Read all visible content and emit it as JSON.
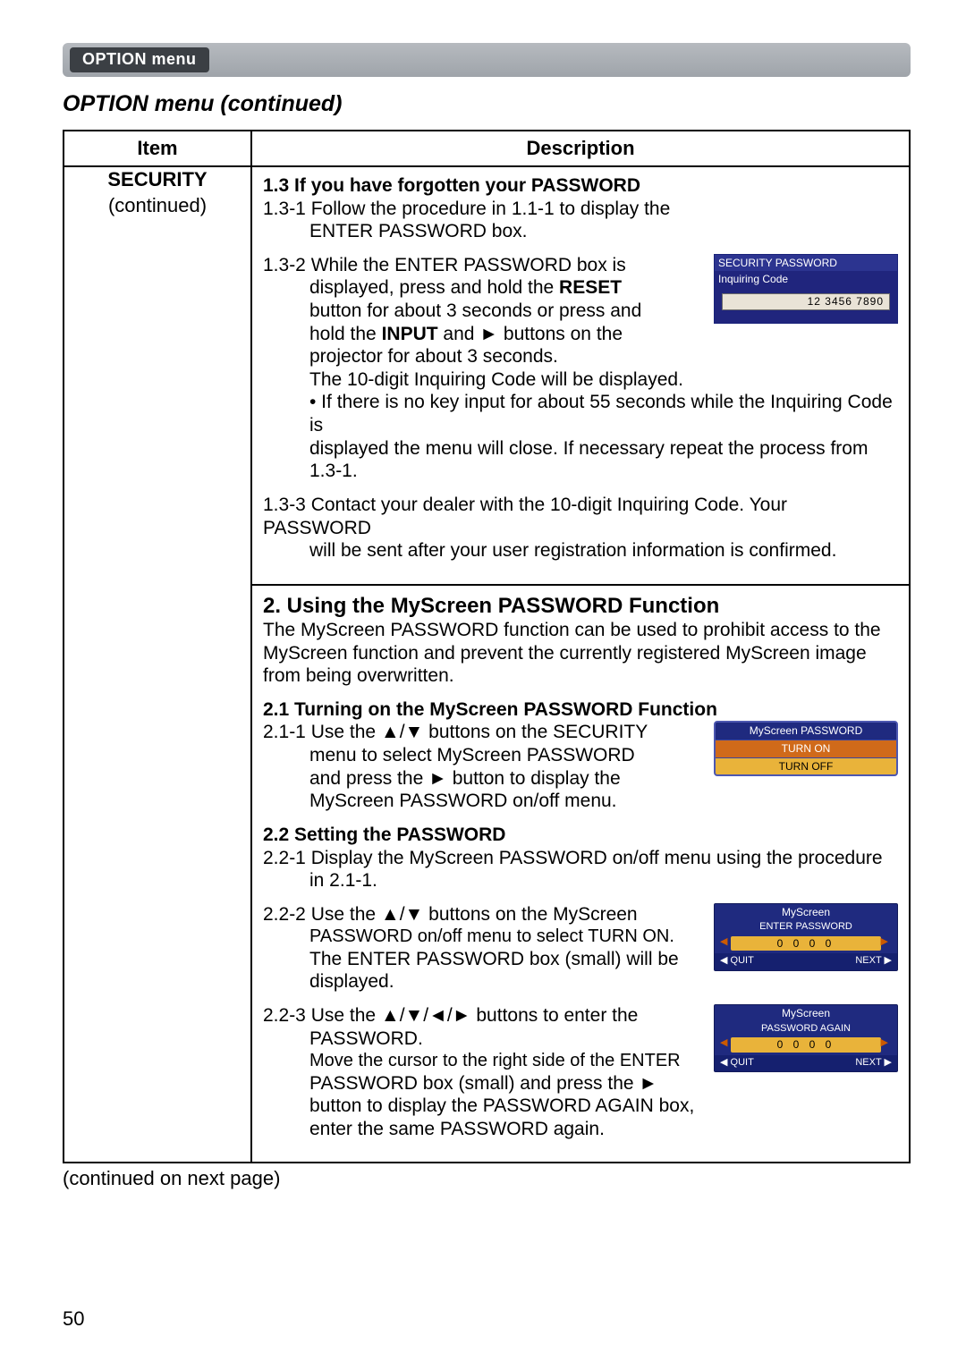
{
  "tab": {
    "label": "OPTION menu"
  },
  "section_title": "OPTION menu (continued)",
  "table": {
    "headers": {
      "item": "Item",
      "description": "Description"
    },
    "item": {
      "name": "SECURITY",
      "sub": "(continued)"
    }
  },
  "s13": {
    "title": "1.3 If you have forgotten your PASSWORD",
    "p1a": "1.3-1 Follow the procedure in 1.1-1 to display the",
    "p1b": "ENTER PASSWORD box.",
    "p2a": "1.3-2 While the ENTER PASSWORD box is",
    "p2b": "displayed, press and hold the ",
    "p2b_bold": "RESET",
    "p2c": "button for about 3 seconds or press and",
    "p2d_a": "hold the ",
    "p2d_bold": "INPUT",
    "p2d_b": " and ► buttons on the",
    "p2e": "projector for about 3 seconds.",
    "p2f": "The 10-digit Inquiring Code will be displayed.",
    "p2g": "• If there is no key input for about 55 seconds while the Inquiring Code is",
    "p2h": "displayed the menu will close. If necessary repeat the process from 1.3-1.",
    "p3a": "1.3-3 Contact your dealer with the 10-digit Inquiring Code. Your PASSWORD",
    "p3b": "will be sent after your user registration information is confirmed."
  },
  "fig1": {
    "bar": "SECURITY PASSWORD",
    "sub": "Inquiring Code",
    "code": "12 3456 7890"
  },
  "s2": {
    "title": "2. Using the MyScreen PASSWORD Function",
    "intro": "The MyScreen PASSWORD function can be used to prohibit access to the MyScreen function and prevent the currently registered MyScreen image from being overwritten."
  },
  "s21": {
    "title": "2.1 Turning on the MyScreen PASSWORD Function",
    "p1a": "2.1-1 Use the ▲/▼ buttons on the SECURITY",
    "p1b": "menu to select MyScreen PASSWORD",
    "p1c": "and press the ► button to display the",
    "p1d": "MyScreen PASSWORD on/off menu."
  },
  "fig2": {
    "title": "MyScreen PASSWORD",
    "on": "TURN ON",
    "off": "TURN OFF"
  },
  "s22": {
    "title": "2.2 Setting the PASSWORD",
    "p1a": "2.2-1 Display the MyScreen PASSWORD on/off menu using the procedure",
    "p1b": "in 2.1-1.",
    "p2a": "2.2-2 Use the ▲/▼ buttons on the MyScreen",
    "p2b": "PASSWORD on/off menu to select TURN ON.",
    "p2c": "The ENTER PASSWORD box (small) will be",
    "p2d": "displayed.",
    "p3a": "2.2-3 Use the ▲/▼/◄/► buttons to enter the",
    "p3b": "PASSWORD.",
    "p3c": "Move the cursor to the right side of the ENTER",
    "p3d": "PASSWORD box (small) and press the ►",
    "p3e": "button to display the PASSWORD AGAIN box,",
    "p3f": "enter the same PASSWORD again."
  },
  "fig3": {
    "t1": "MyScreen",
    "t2": "ENTER PASSWORD",
    "digits": "0 0 0 0",
    "quit": "◀ QUIT",
    "next": "NEXT ▶"
  },
  "fig4": {
    "t1": "MyScreen",
    "t2": "PASSWORD AGAIN",
    "digits": "0 0 0 0",
    "quit": "◀ QUIT",
    "next": "NEXT ▶"
  },
  "continued_note": "(continued on next page)",
  "page_number": "50"
}
